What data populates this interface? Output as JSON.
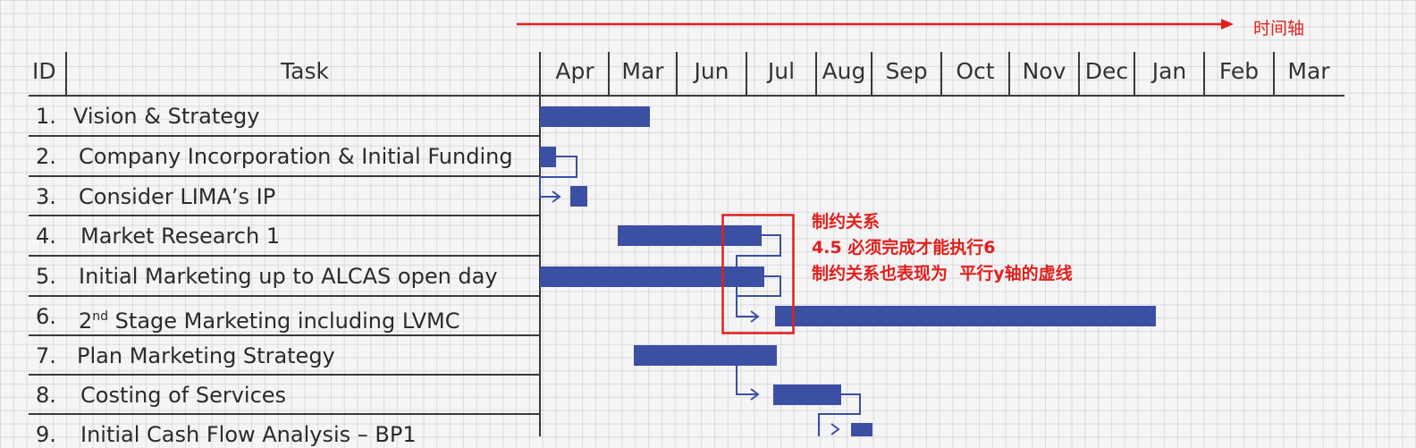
{
  "timeline_caption": "时间轴",
  "headers": {
    "id": "ID",
    "task": "Task"
  },
  "months": [
    "Apr",
    "Mar",
    "Jun",
    "Jul",
    "Aug",
    "Sep",
    "Oct",
    "Nov",
    "Dec",
    "Jan",
    "Feb",
    "Mar"
  ],
  "tasks": [
    {
      "id": "1.",
      "name": "Vision & Strategy"
    },
    {
      "id": "2.",
      "name": "Company Incorporation & Initial Funding"
    },
    {
      "id": "3.",
      "name": "Consider LIMA’s IP"
    },
    {
      "id": "4.",
      "name": "Market Research 1"
    },
    {
      "id": "5.",
      "name": "Initial Marketing up to ALCAS open day"
    },
    {
      "id": "6.",
      "name_prefix": "2",
      "name_sup": "nd",
      "name_rest": " Stage Marketing including LVMC"
    },
    {
      "id": "7.",
      "name": "Plan Marketing Strategy"
    },
    {
      "id": "8.",
      "name": "Costing of Services"
    },
    {
      "id": "9.",
      "name": "Initial Cash Flow Analysis – BP1"
    }
  ],
  "annotations": [
    "制约关系",
    "4.5 必须完成才能执行6",
    "制约关系也表现为  平行y轴的虚线"
  ],
  "colors": {
    "bar": "#3b4fa3",
    "annotation": "#e0201c",
    "grid_line": "#3a3a3a"
  }
}
